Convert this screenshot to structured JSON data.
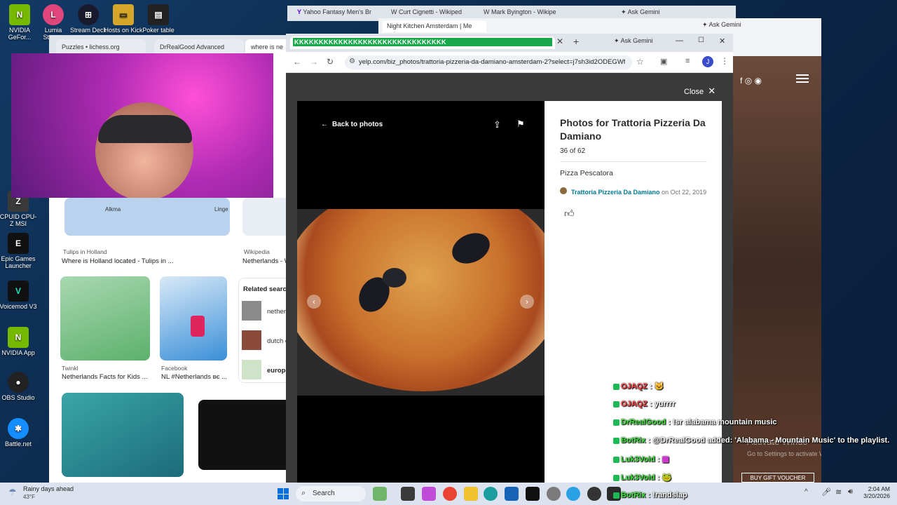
{
  "desktop": {
    "icons": [
      {
        "label": "NVIDIA GeFor...",
        "color": "#76b900",
        "glyph": "N"
      },
      {
        "label": "Lumia Stream",
        "color": "#e0457b",
        "glyph": "L"
      },
      {
        "label": "Stream Deck",
        "color": "#1a1a2e",
        "glyph": "⊞"
      },
      {
        "label": "Hosts on Kick",
        "color": "#d6a62a",
        "glyph": "▭"
      },
      {
        "label": "Poker table",
        "color": "#222",
        "glyph": "▤"
      },
      {
        "label": "CPUID CPU-Z MSI",
        "color": "#3a3a3a",
        "glyph": "Z"
      },
      {
        "label": "Epic Games Launcher",
        "color": "#111",
        "glyph": "E"
      },
      {
        "label": "Voicemod V3",
        "color": "#111",
        "glyph": "V"
      },
      {
        "label": "NVIDIA App",
        "color": "#76b900",
        "glyph": "N"
      },
      {
        "label": "OBS Studio",
        "color": "#222",
        "glyph": "●"
      },
      {
        "label": "Battle.net",
        "color": "#148eff",
        "glyph": "✱"
      }
    ]
  },
  "back_browser": {
    "tabs": [
      "Puzzles • lichess.org",
      "DrRealGood Advanced",
      "where is ne"
    ],
    "cards": [
      {
        "source": "Tulips in Holland",
        "title": "Where is Holland located - Tulips in ..."
      },
      {
        "source": "Wikipedia",
        "title": "Netherlands - W"
      },
      {
        "source": "Twinkl",
        "title": "Netherlands Facts for Kids ..."
      },
      {
        "source": "Facebook",
        "title": "NL #Netherlands вє ..."
      }
    ],
    "related_heading": "Related search",
    "related": [
      "nether",
      "dutch c",
      "europe"
    ],
    "small_map_labels": [
      "Alkma",
      "Linge"
    ]
  },
  "yahoo_tabs": [
    "Yahoo Fantasy Men's Br",
    "Curt Cignetti - Wikiped",
    "Mark Byington - Wikipe"
  ],
  "gemini_label": "Ask Gemini",
  "nk_tab": "Night Kitchen Amsterdam | Me",
  "main_browser": {
    "tab_text": "KKKKKKKKKKKKKKKKKKKKKKKKKKKKKKK",
    "url": "yelp.com/biz_photos/trattoria-pizzeria-da-damiano-amsterdam-2?select=j7sh3id2ODEGWf...",
    "profile_initial": "J"
  },
  "lightbox": {
    "close_label": "Close",
    "back_label": "Back to photos",
    "title": "Photos for Trattoria Pizzeria Da Damiano",
    "counter": "36 of 62",
    "caption": "Pizza Pescatora",
    "author": "Trattoria Pizzeria Da Damiano",
    "date": "on Oct 22, 2019"
  },
  "right_bg": {
    "activate": "Activate Windo",
    "activate_sub": "Go to Settings to activate Windows.",
    "gift": "BUY GIFT VOUCHER"
  },
  "chat": [
    {
      "user": "OJAQZ",
      "msg": "🐱",
      "color": "#ff4545"
    },
    {
      "user": "OJAQZ",
      "msg": "yurrrr",
      "color": "#ff4545"
    },
    {
      "user": "DrRealGood",
      "msg": "!sr alabama mountain music",
      "color": "#3ee23e"
    },
    {
      "user": "BotRix",
      "msg": "@DrRealGood added: 'Alabama - Mountain Music' to the playlist.",
      "color": "#3ee23e"
    },
    {
      "user": "Luk3Void",
      "msg": "▦",
      "color": "#3ee23e"
    },
    {
      "user": "Luk3Void",
      "msg": "🐸",
      "color": "#3ee23e"
    },
    {
      "user": "BotRix",
      "msg": "!randslap",
      "color": "#3ee23e"
    }
  ],
  "taskbar": {
    "weather_title": "Rainy days ahead",
    "weather_temp": "43°F",
    "search": "Search",
    "time": "2:04 AM",
    "date": "3/20/2026"
  }
}
